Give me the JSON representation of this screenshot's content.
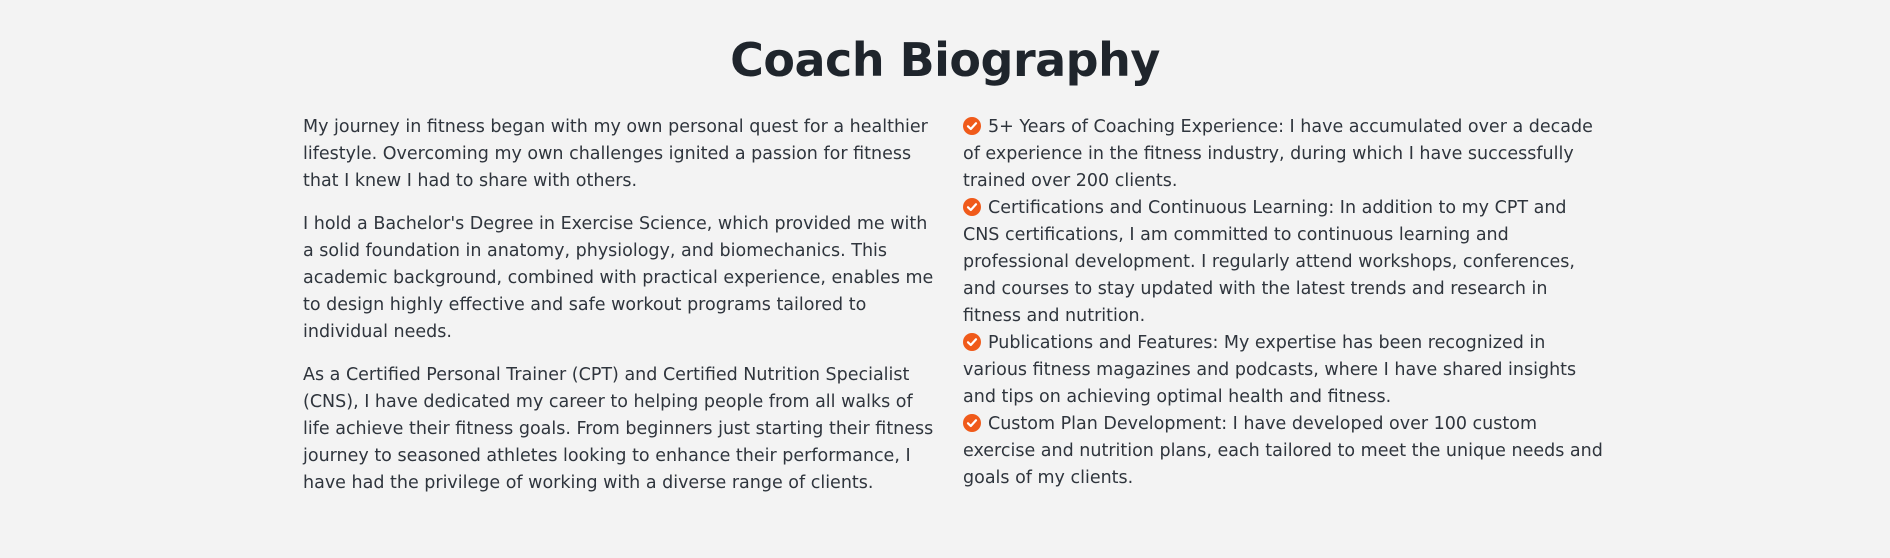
{
  "title": "Coach Biography",
  "paragraphs": [
    "My journey in fitness began with my own personal quest for a healthier lifestyle. Overcoming my own challenges ignited a passion for fitness that I knew I had to share with others.",
    "I hold a Bachelor's Degree in Exercise Science, which provided me with a solid foundation in anatomy, physiology, and biomechanics. This academic background, combined with practical experience, enables me to design highly effective and safe workout programs tailored to individual needs.",
    "As a Certified Personal Trainer (CPT) and Certified Nutrition Specialist (CNS), I have dedicated my career to helping people from all walks of life achieve their fitness goals. From beginners just starting their fitness journey to seasoned athletes looking to enhance their performance, I have had the privilege of working with a diverse range of clients."
  ],
  "highlights": [
    "5+ Years of Coaching Experience: I have accumulated over a decade of experience in the fitness industry, during which I have successfully trained over 200 clients.",
    "Certifications and Continuous Learning: In addition to my CPT and CNS certifications, I am committed to continuous learning and professional development. I regularly attend workshops, conferences, and courses to stay updated with the latest trends and research in fitness and nutrition.",
    "Publications and Features: My expertise has been recognized in various fitness magazines and podcasts, where I have shared insights and tips on achieving optimal health and fitness.",
    "Custom Plan Development: I have developed over 100 custom exercise and nutrition plans, each tailored to meet the unique needs and goals of my clients."
  ],
  "icons": {
    "highlight_icon": "check-circle-icon"
  },
  "colors": {
    "accent": "#f05a1a",
    "heading": "#1f252c",
    "text": "#2f353d",
    "background": "#f3f3f3"
  }
}
